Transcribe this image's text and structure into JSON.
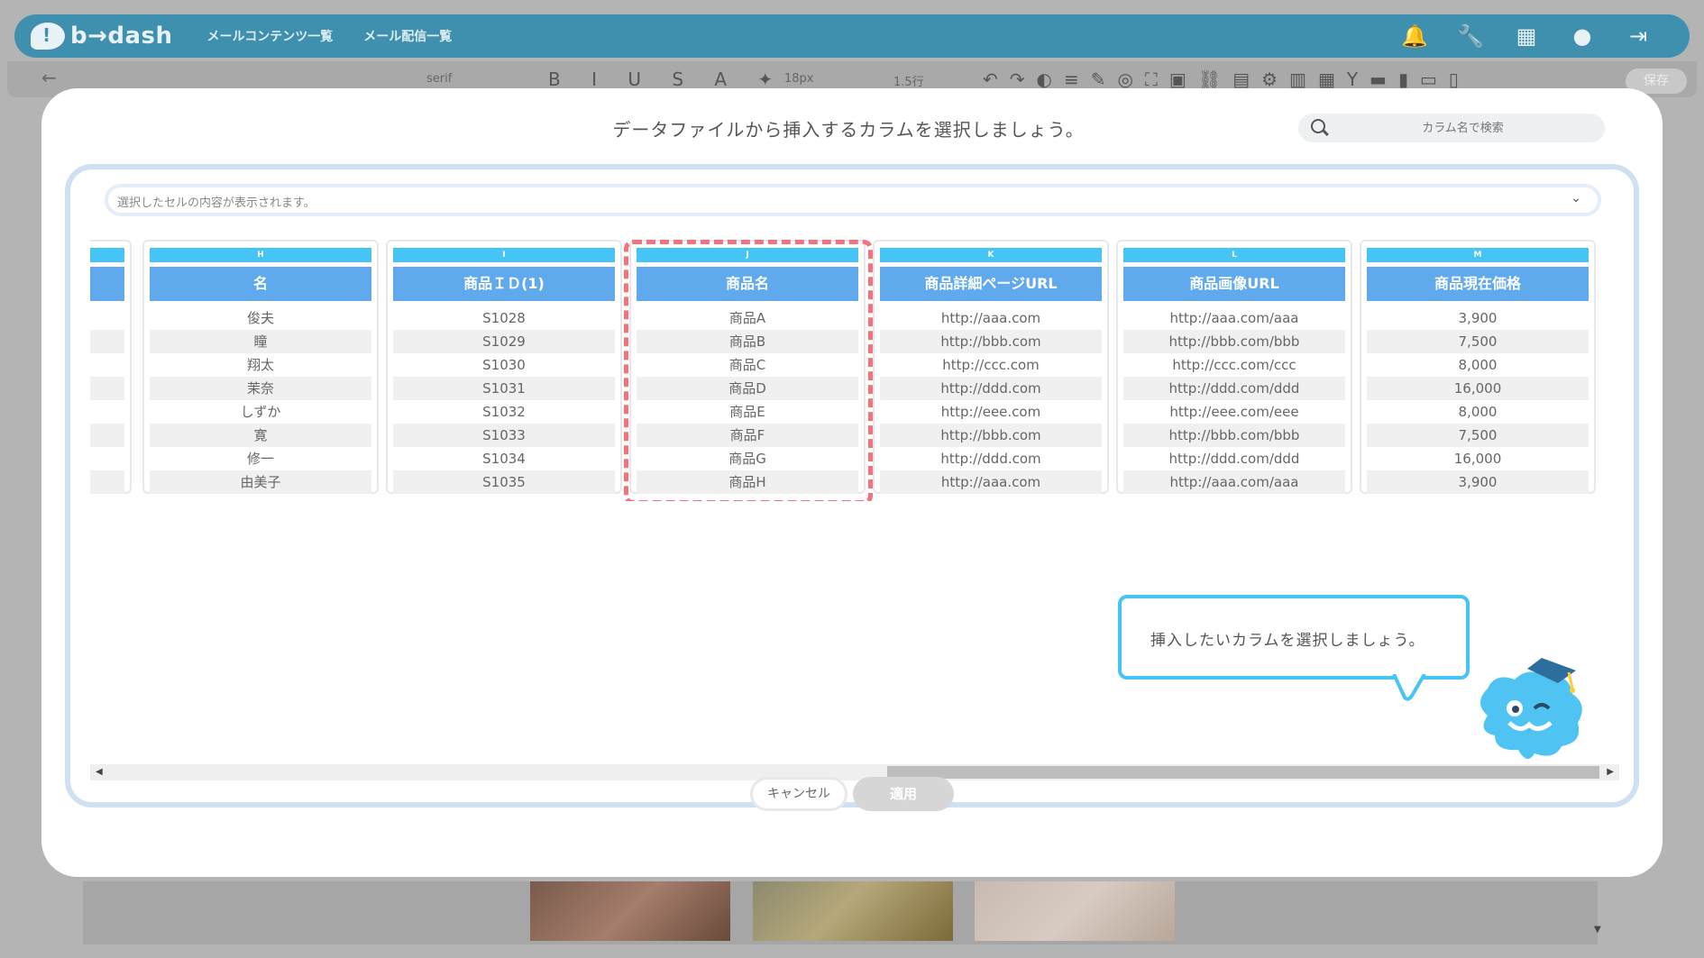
{
  "app": {
    "logo_text": "b→dash",
    "nav": [
      "メールコンテンツ一覧",
      "メール配信一覧"
    ]
  },
  "toolbar": {
    "font": "serif",
    "size": "18px",
    "line_height": "1.5行",
    "save_label": "保存"
  },
  "modal": {
    "title": "データファイルから挿入するカラムを選択しましょう。",
    "search_placeholder": "カラム名で検索",
    "cell_preview_placeholder": "選択したセルの内容が表示されます。",
    "columns": [
      {
        "letter": "H",
        "name": "名",
        "rows": [
          "俊夫",
          "瞳",
          "翔太",
          "茉奈",
          "しずか",
          "寛",
          "修一",
          "由美子"
        ]
      },
      {
        "letter": "I",
        "name": "商品ＩＤ(1)",
        "rows": [
          "S1028",
          "S1029",
          "S1030",
          "S1031",
          "S1032",
          "S1033",
          "S1034",
          "S1035"
        ]
      },
      {
        "letter": "J",
        "name": "商品名",
        "rows": [
          "商品A",
          "商品B",
          "商品C",
          "商品D",
          "商品E",
          "商品F",
          "商品G",
          "商品H"
        ],
        "selected": true
      },
      {
        "letter": "K",
        "name": "商品詳細ページURL",
        "rows": [
          "http://aaa.com",
          "http://bbb.com",
          "http://ccc.com",
          "http://ddd.com",
          "http://eee.com",
          "http://bbb.com",
          "http://ddd.com",
          "http://aaa.com"
        ]
      },
      {
        "letter": "L",
        "name": "商品画像URL",
        "rows": [
          "http://aaa.com/aaa",
          "http://bbb.com/bbb",
          "http://ccc.com/ccc",
          "http://ddd.com/ddd",
          "http://eee.com/eee",
          "http://bbb.com/bbb",
          "http://ddd.com/ddd",
          "http://aaa.com/aaa"
        ]
      },
      {
        "letter": "M",
        "name": "商品現在価格",
        "rows": [
          "3,900",
          "7,500",
          "8,000",
          "16,000",
          "8,000",
          "7,500",
          "16,000",
          "3,900"
        ]
      }
    ],
    "tooltip": "挿入したいカラムを選択しましょう。",
    "cancel_label": "キャンセル",
    "apply_label": "適用"
  },
  "colors": {
    "topbar": "#3f8fae",
    "column_letter": "#45c4f5",
    "column_header": "#5fa9ec",
    "selected_outline": "#f2737d",
    "tooltip_border": "#45c4f5"
  }
}
